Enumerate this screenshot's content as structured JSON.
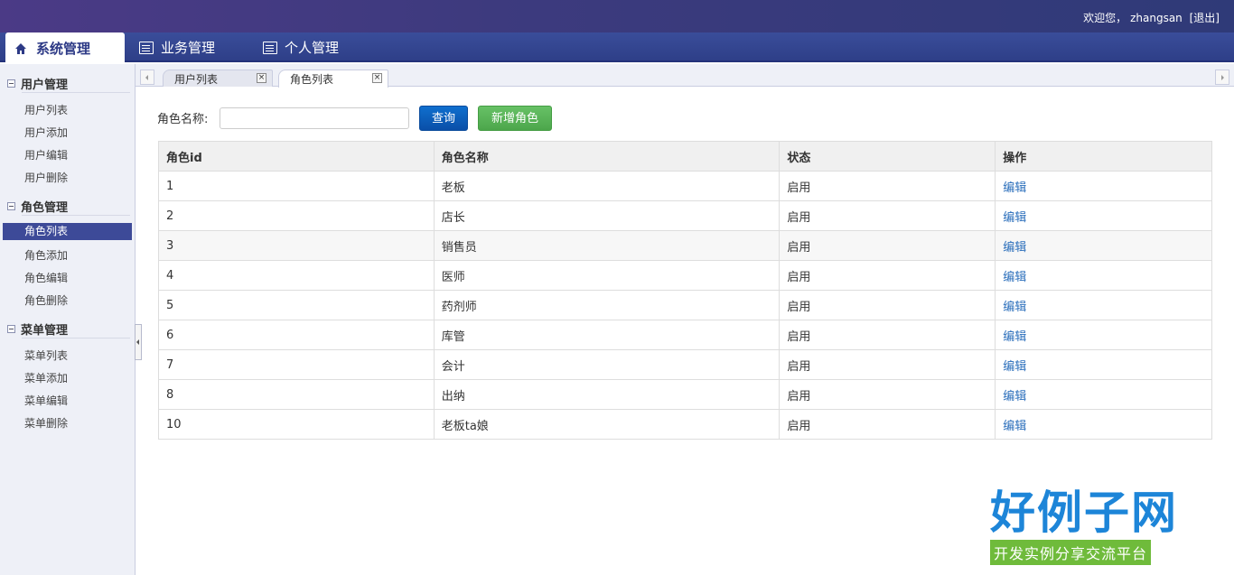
{
  "topbar": {
    "welcome": "欢迎您，",
    "username": "zhangsan",
    "logout": "[退出]"
  },
  "nav": {
    "tabs": [
      {
        "label": "系统管理",
        "icon": "home-icon"
      },
      {
        "label": "业务管理",
        "icon": "list-icon"
      },
      {
        "label": "个人管理",
        "icon": "list-icon"
      }
    ]
  },
  "sidebar": {
    "groups": [
      {
        "title": "用户管理",
        "items": [
          "用户列表",
          "用户添加",
          "用户编辑",
          "用户删除"
        ]
      },
      {
        "title": "角色管理",
        "items": [
          "角色列表",
          "角色添加",
          "角色编辑",
          "角色删除"
        ]
      },
      {
        "title": "菜单管理",
        "items": [
          "菜单列表",
          "菜单添加",
          "菜单编辑",
          "菜单删除"
        ]
      }
    ],
    "active_item": "角色列表"
  },
  "page_tabs": [
    {
      "label": "用户列表",
      "close": "×"
    },
    {
      "label": "角色列表",
      "close": "×"
    }
  ],
  "filter": {
    "label": "角色名称:",
    "value": "",
    "query_button": "查询",
    "add_button": "新增角色"
  },
  "table": {
    "headers": [
      "角色id",
      "角色名称",
      "状态",
      "操作"
    ],
    "rows": [
      {
        "id": "1",
        "name": "老板",
        "status": "启用",
        "action": "编辑"
      },
      {
        "id": "2",
        "name": "店长",
        "status": "启用",
        "action": "编辑"
      },
      {
        "id": "3",
        "name": "销售员",
        "status": "启用",
        "action": "编辑"
      },
      {
        "id": "4",
        "name": "医师",
        "status": "启用",
        "action": "编辑"
      },
      {
        "id": "5",
        "name": "药剂师",
        "status": "启用",
        "action": "编辑"
      },
      {
        "id": "6",
        "name": "库管",
        "status": "启用",
        "action": "编辑"
      },
      {
        "id": "7",
        "name": "会计",
        "status": "启用",
        "action": "编辑"
      },
      {
        "id": "8",
        "name": "出纳",
        "status": "启用",
        "action": "编辑"
      },
      {
        "id": "10",
        "name": "老板ta娘",
        "status": "启用",
        "action": "编辑"
      }
    ]
  },
  "watermark": {
    "title": "好例子网",
    "subtitle": "开发实例分享交流平台"
  },
  "colors": {
    "nav_bg": "#2e3f88",
    "active_item_bg": "#3d4a98",
    "query_btn": "#0a4fa8",
    "add_btn": "#4ca64b",
    "link": "#2a6ebb"
  }
}
